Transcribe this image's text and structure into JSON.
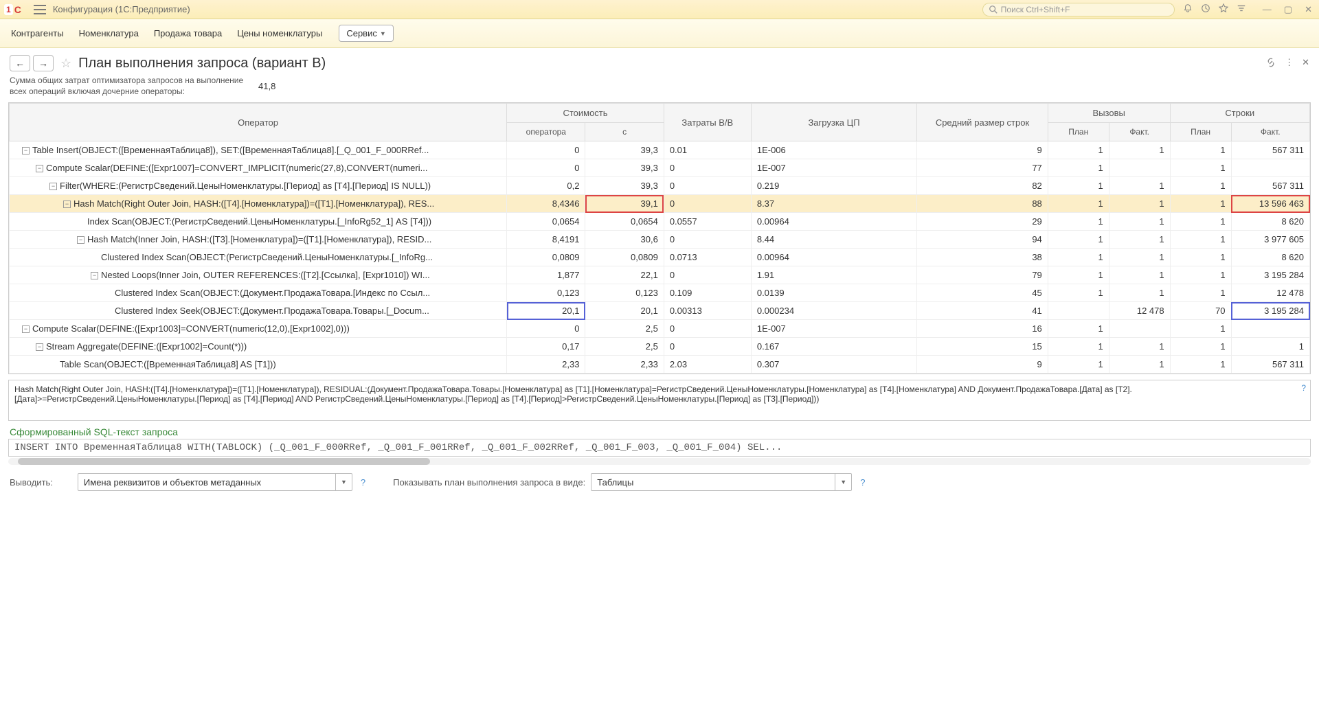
{
  "titlebar": {
    "app_title": "Конфигурация (1С:Предприятие)",
    "search_placeholder": "Поиск Ctrl+Shift+F"
  },
  "menu": {
    "items": [
      "Контрагенты",
      "Номенклатура",
      "Продажа товара",
      "Цены номенклатуры"
    ],
    "service": "Сервис"
  },
  "page": {
    "title": "План выполнения запроса (вариант B)",
    "summary_label": "Сумма общих затрат оптимизатора запросов на выполнение всех операций включая дочерние операторы:",
    "summary_value": "41,8"
  },
  "headers": {
    "operator": "Оператор",
    "cost": "Стоимость",
    "cost_op": "оператора",
    "cost_c": "с",
    "io": "Затраты В/В",
    "cpu": "Загрузка ЦП",
    "row_size": "Средний размер строк",
    "calls": "Вызовы",
    "rows": "Строки",
    "plan": "План",
    "fact": "Факт."
  },
  "rows": [
    {
      "indent": 0,
      "toggle": "-",
      "op": "Table Insert(OBJECT:([ВременнаяТаблица8]), SET:([ВременнаяТаблица8].[_Q_001_F_000RRef...",
      "cost_op": "0",
      "cost_c": "39,3",
      "io": "0.01",
      "cpu": "1E-006",
      "rsz": "9",
      "cp": "1",
      "cf": "1",
      "rp": "1",
      "rf": "567 311"
    },
    {
      "indent": 1,
      "toggle": "-",
      "op": "Compute Scalar(DEFINE:([Expr1007]=CONVERT_IMPLICIT(numeric(27,8),CONVERT(numeri...",
      "cost_op": "0",
      "cost_c": "39,3",
      "io": "0",
      "cpu": "1E-007",
      "rsz": "77",
      "cp": "1",
      "cf": "",
      "rp": "1",
      "rf": ""
    },
    {
      "indent": 2,
      "toggle": "-",
      "op": "Filter(WHERE:(РегистрСведений.ЦеныНоменклатуры.[Период] as [T4].[Период] IS NULL))",
      "cost_op": "0,2",
      "cost_c": "39,3",
      "io": "0",
      "cpu": "0.219",
      "rsz": "82",
      "cp": "1",
      "cf": "1",
      "rp": "1",
      "rf": "567 311"
    },
    {
      "indent": 3,
      "toggle": "-",
      "selected": true,
      "op": "Hash Match(Right Outer Join, HASH:([T4].[Номенклатура])=([T1].[Номенклатура]), RES...",
      "cost_op": "8,4346",
      "cost_c": "39,1",
      "cost_c_hl": "red",
      "io": "0",
      "cpu": "8.37",
      "rsz": "88",
      "cp": "1",
      "cf": "1",
      "rp": "1",
      "rf": "13 596 463",
      "rf_hl": "red"
    },
    {
      "indent": 4,
      "toggle": "",
      "op": "Index Scan(OBJECT:(РегистрСведений.ЦеныНоменклатуры.[_InfoRg52_1] AS [T4]))",
      "cost_op": "0,0654",
      "cost_c": "0,0654",
      "io": "0.0557",
      "cpu": "0.00964",
      "rsz": "29",
      "cp": "1",
      "cf": "1",
      "rp": "1",
      "rf": "8 620"
    },
    {
      "indent": 4,
      "toggle": "-",
      "op": "Hash Match(Inner Join, HASH:([T3].[Номенклатура])=([T1].[Номенклатура]), RESID...",
      "cost_op": "8,4191",
      "cost_c": "30,6",
      "io": "0",
      "cpu": "8.44",
      "rsz": "94",
      "cp": "1",
      "cf": "1",
      "rp": "1",
      "rf": "3 977 605"
    },
    {
      "indent": 5,
      "toggle": "",
      "op": "Clustered Index Scan(OBJECT:(РегистрСведений.ЦеныНоменклатуры.[_InfoRg...",
      "cost_op": "0,0809",
      "cost_c": "0,0809",
      "io": "0.0713",
      "cpu": "0.00964",
      "rsz": "38",
      "cp": "1",
      "cf": "1",
      "rp": "1",
      "rf": "8 620"
    },
    {
      "indent": 5,
      "toggle": "-",
      "op": "Nested Loops(Inner Join, OUTER REFERENCES:([T2].[Ссылка], [Expr1010]) WI...",
      "cost_op": "1,877",
      "cost_c": "22,1",
      "io": "0",
      "cpu": "1.91",
      "rsz": "79",
      "cp": "1",
      "cf": "1",
      "rp": "1",
      "rf": "3 195 284"
    },
    {
      "indent": 6,
      "toggle": "",
      "op": "Clustered Index Scan(OBJECT:(Документ.ПродажаТовара.[Индекс по Ссыл...",
      "cost_op": "0,123",
      "cost_c": "0,123",
      "io": "0.109",
      "cpu": "0.0139",
      "rsz": "45",
      "cp": "1",
      "cf": "1",
      "rp": "1",
      "rf": "12 478"
    },
    {
      "indent": 6,
      "toggle": "",
      "op": "Clustered Index Seek(OBJECT:(Документ.ПродажаТовара.Товары.[_Docum...",
      "cost_op": "20,1",
      "cost_op_hl": "blue",
      "cost_c": "20,1",
      "io": "0.00313",
      "cpu": "0.000234",
      "rsz": "41",
      "cp": "",
      "cf": "12 478",
      "rp": "70",
      "rf": "3 195 284",
      "rf_hl": "blue"
    },
    {
      "indent": 0,
      "toggle": "-",
      "op": "Compute Scalar(DEFINE:([Expr1003]=CONVERT(numeric(12,0),[Expr1002],0)))",
      "cost_op": "0",
      "cost_c": "2,5",
      "io": "0",
      "cpu": "1E-007",
      "rsz": "16",
      "cp": "1",
      "cf": "",
      "rp": "1",
      "rf": ""
    },
    {
      "indent": 1,
      "toggle": "-",
      "op": "Stream Aggregate(DEFINE:([Expr1002]=Count(*)))",
      "cost_op": "0,17",
      "cost_c": "2,5",
      "io": "0",
      "cpu": "0.167",
      "rsz": "15",
      "cp": "1",
      "cf": "1",
      "rp": "1",
      "rf": "1"
    },
    {
      "indent": 2,
      "toggle": "",
      "op": "Table Scan(OBJECT:([ВременнаяТаблица8] AS [T1]))",
      "cost_op": "2,33",
      "cost_c": "2,33",
      "io": "2.03",
      "cpu": "0.307",
      "rsz": "9",
      "cp": "1",
      "cf": "1",
      "rp": "1",
      "rf": "567 311"
    }
  ],
  "detail_text": "Hash Match(Right Outer Join, HASH:([T4].[Номенклатура])=([T1].[Номенклатура]), RESIDUAL:(Документ.ПродажаТовара.Товары.[Номенклатура] as [T1].[Номенклатура]=РегистрСведений.ЦеныНоменклатуры.[Номенклатура] as [T4].[Номенклатура] AND Документ.ПродажаТовара.[Дата] as [T2].[Дата]>=РегистрСведений.ЦеныНоменклатуры.[Период] as [T4].[Период] AND РегистрСведений.ЦеныНоменклатуры.[Период] as [T4].[Период]>РегистрСведений.ЦеныНоменклатуры.[Период] as [T3].[Период]))",
  "section_sql": "Сформированный SQL-текст запроса",
  "sql_text": "INSERT INTO ВременнаяТаблица8 WITH(TABLOCK) (_Q_001_F_000RRef, _Q_001_F_001RRef, _Q_001_F_002RRef, _Q_001_F_003, _Q_001_F_004) SEL...",
  "bottom": {
    "output_label": "Выводить:",
    "output_value": "Имена реквизитов и объектов метаданных",
    "view_label": "Показывать план выполнения запроса в виде:",
    "view_value": "Таблицы"
  }
}
